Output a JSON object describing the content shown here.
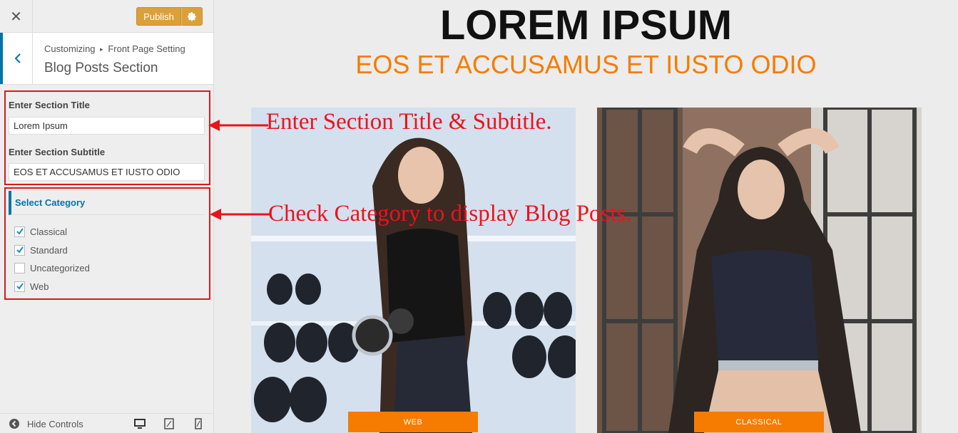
{
  "header": {
    "publish_label": "Publish",
    "close_icon": "close-icon",
    "settings_icon": "gear-icon"
  },
  "section": {
    "breadcrumb_parent": "Customizing",
    "breadcrumb_separator": "▸",
    "breadcrumb_child": "Front Page Setting",
    "title": "Blog Posts Section"
  },
  "fields": {
    "title_label": "Enter Section Title",
    "title_value": "Lorem Ipsum",
    "subtitle_label": "Enter Section Subtitle",
    "subtitle_value": "EOS ET ACCUSAMUS ET IUSTO ODIO"
  },
  "category": {
    "heading": "Select Category",
    "items": [
      {
        "label": "Classical",
        "checked": true
      },
      {
        "label": "Standard",
        "checked": true
      },
      {
        "label": "Uncategorized",
        "checked": false
      },
      {
        "label": "Web",
        "checked": true
      }
    ]
  },
  "footer": {
    "hide_controls_label": "Hide Controls"
  },
  "preview": {
    "title": "LOREM IPSUM",
    "subtitle": "EOS ET ACCUSAMUS ET IUSTO ODIO",
    "posts": [
      {
        "tag": "WEB"
      },
      {
        "tag": "CLASSICAL"
      }
    ]
  },
  "annotations": {
    "first": "Enter Section Title & Subtitle.",
    "second": "Check Category to display Blog Posts."
  },
  "colors": {
    "accent": "#0073aa",
    "publish": "#dca03b",
    "preview_accent": "#f57c00",
    "annotation": "#e8141d"
  }
}
